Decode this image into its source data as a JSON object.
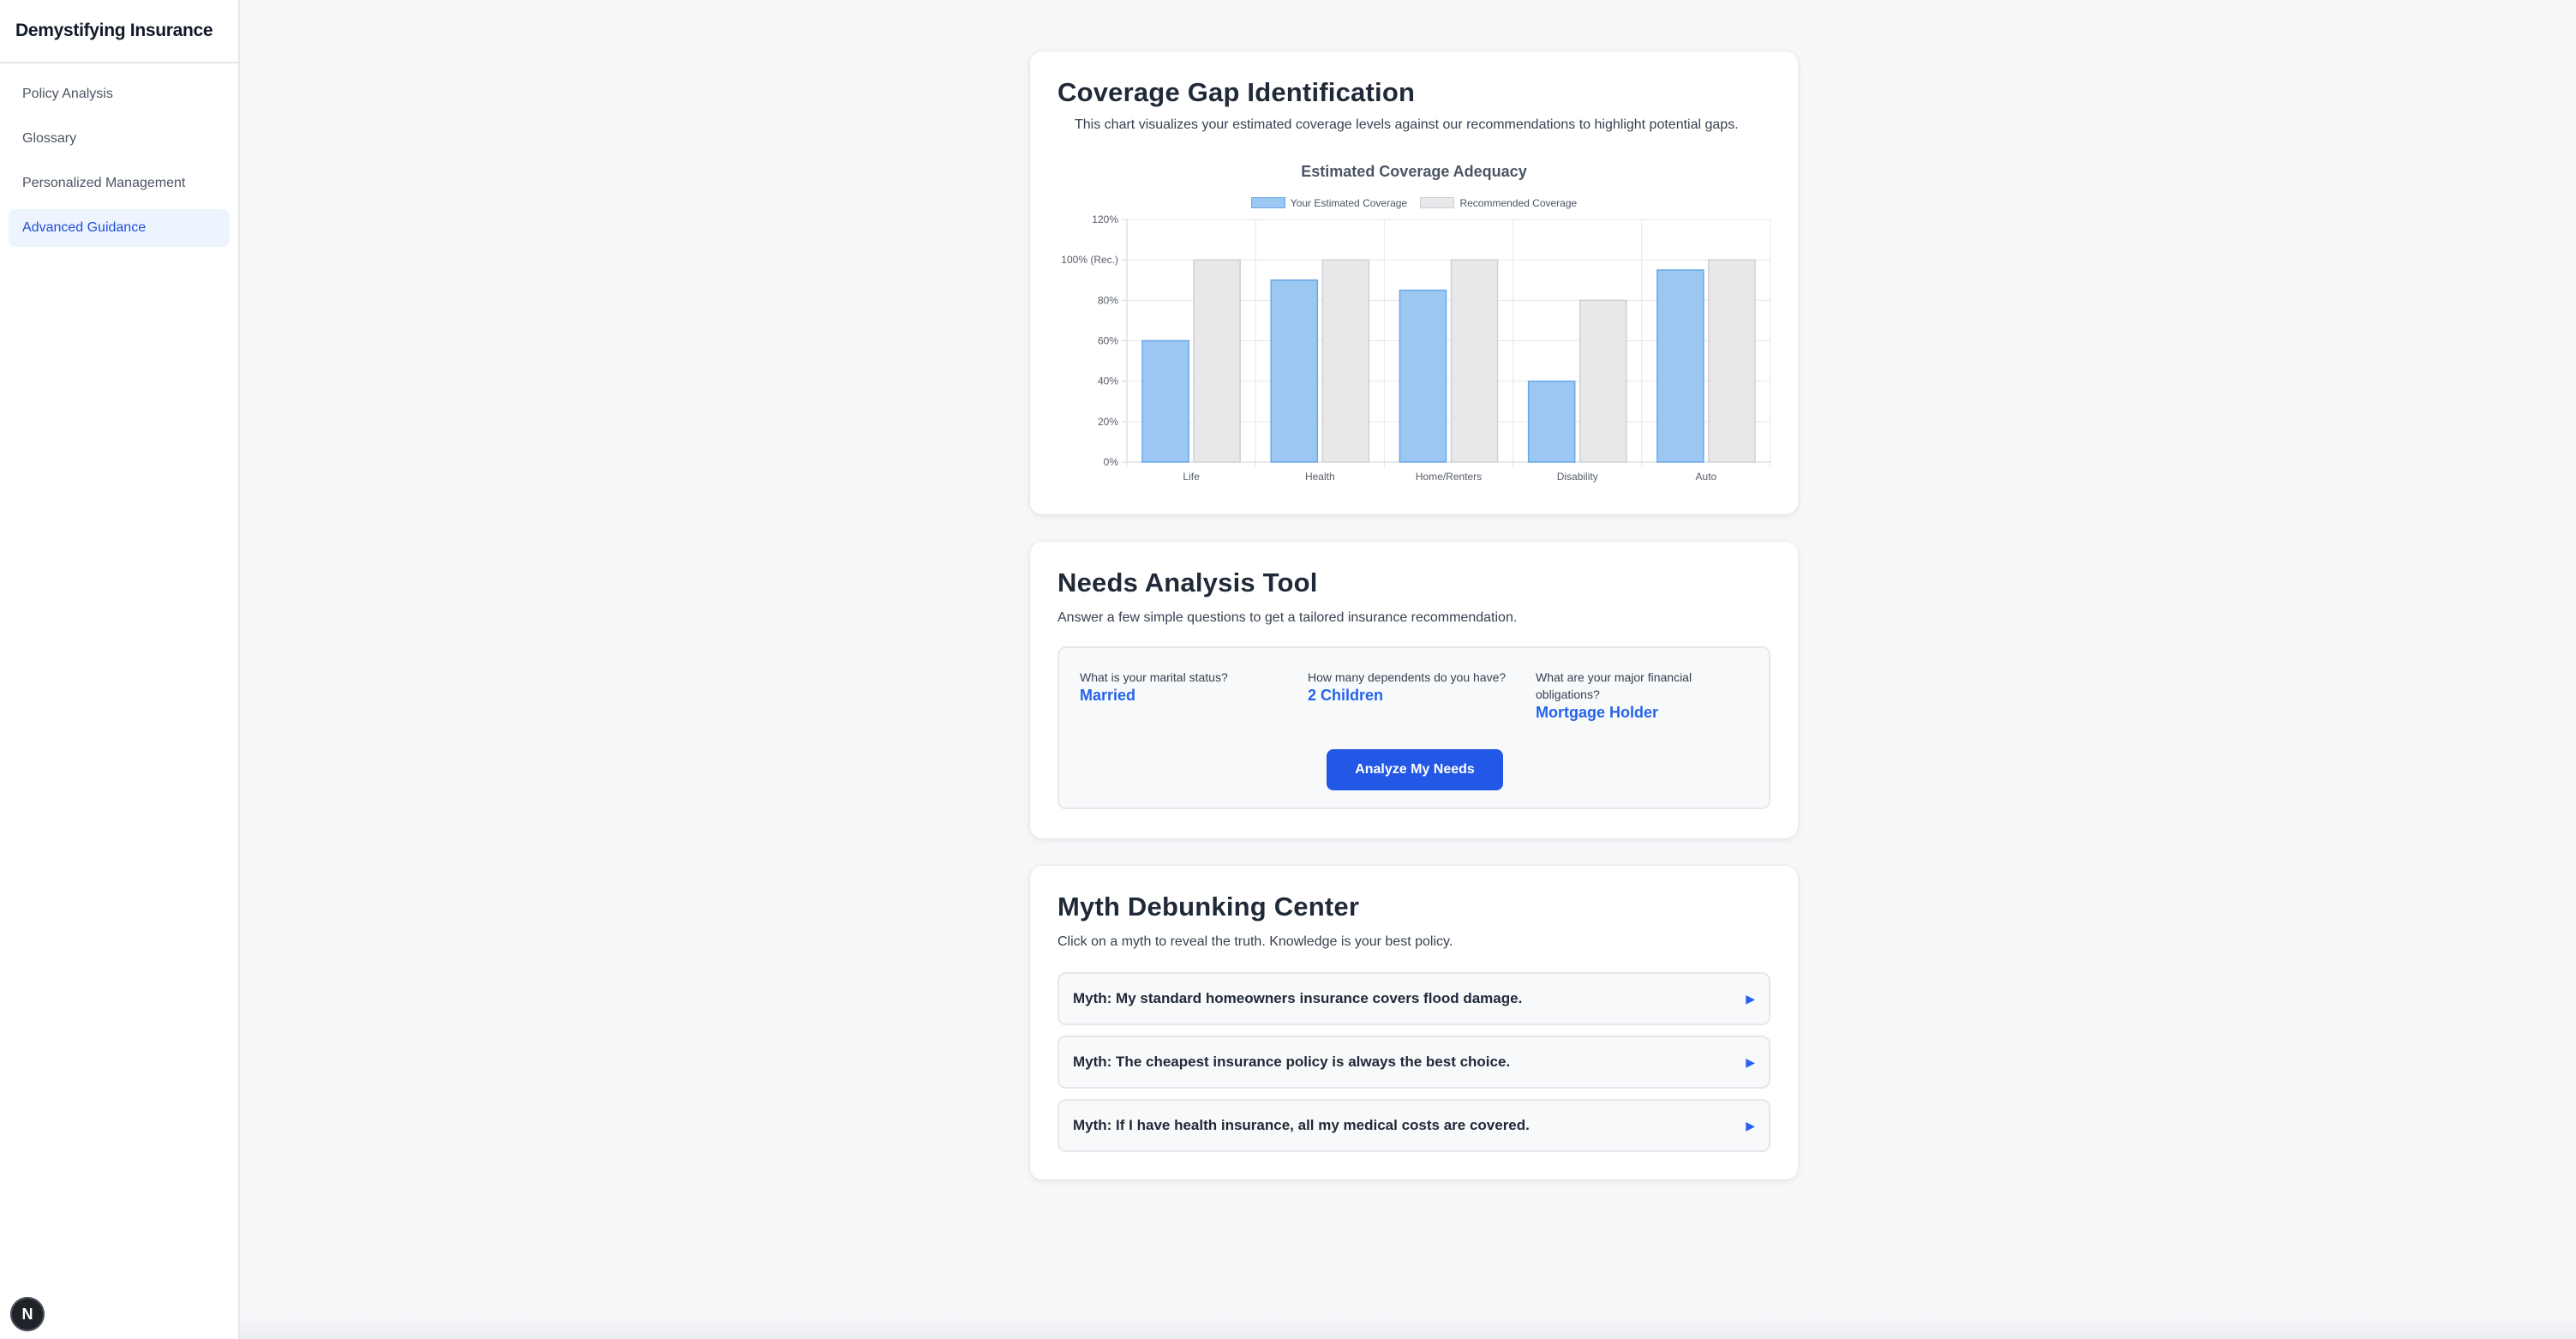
{
  "app": {
    "title": "Demystifying Insurance"
  },
  "sidebar": {
    "items": [
      {
        "label": "Policy Analysis",
        "active": false
      },
      {
        "label": "Glossary",
        "active": false
      },
      {
        "label": "Personalized Management",
        "active": false
      },
      {
        "label": "Advanced Guidance",
        "active": true
      }
    ]
  },
  "badge": {
    "letter": "N"
  },
  "coverage": {
    "title": "Coverage Gap Identification",
    "subtitle": "This chart visualizes your estimated coverage levels against our recommendations to highlight potential gaps."
  },
  "chart_data": {
    "type": "bar",
    "title": "Estimated Coverage Adequacy",
    "categories": [
      "Life",
      "Health",
      "Home/Renters",
      "Disability",
      "Auto"
    ],
    "series": [
      {
        "name": "Your Estimated Coverage",
        "values": [
          60,
          90,
          85,
          40,
          95
        ],
        "color": "#9cc7f2",
        "border": "#6aa8e8"
      },
      {
        "name": "Recommended Coverage",
        "values": [
          100,
          100,
          100,
          80,
          100
        ],
        "color": "#e8e8ea",
        "border": "#cfd0d4"
      }
    ],
    "ylim": [
      0,
      120
    ],
    "yticks": [
      "0%",
      "20%",
      "40%",
      "60%",
      "80%",
      "100% (Rec.)",
      "120%"
    ],
    "grid": true,
    "legend": "top"
  },
  "needs": {
    "title": "Needs Analysis Tool",
    "subtitle": "Answer a few simple questions to get a tailored insurance recommendation.",
    "questions": [
      {
        "label": "What is your marital status?",
        "answer": "Married"
      },
      {
        "label": "How many dependents do you have?",
        "answer": "2 Children"
      },
      {
        "label": "What are your major financial obligations?",
        "answer": "Mortgage Holder"
      }
    ],
    "button_label": "Analyze My Needs"
  },
  "myths": {
    "title": "Myth Debunking Center",
    "subtitle": "Click on a myth to reveal the truth. Knowledge is your best policy.",
    "items": [
      {
        "text": "Myth: My standard homeowners insurance covers flood damage.",
        "icon": "triangle-right-icon"
      },
      {
        "text": "Myth: The cheapest insurance policy is always the best choice.",
        "icon": "triangle-right-icon"
      },
      {
        "text": "Myth: If I have health insurance, all my medical costs are covered.",
        "icon": "triangle-right-icon"
      }
    ]
  }
}
